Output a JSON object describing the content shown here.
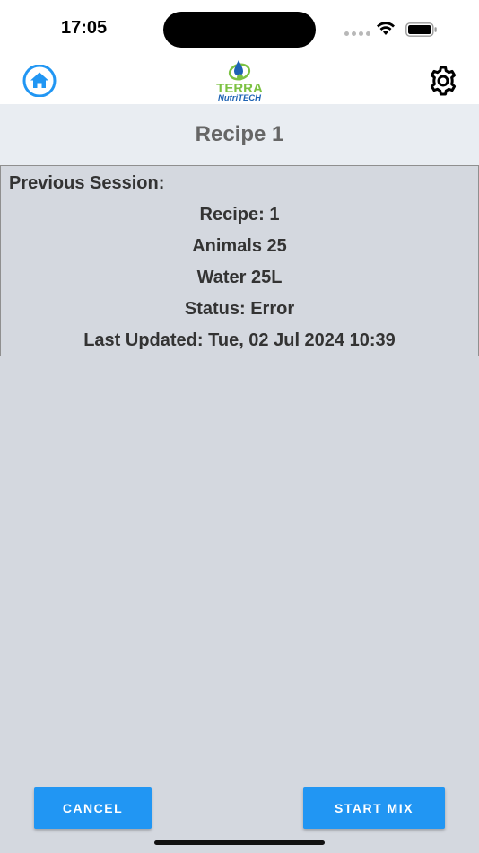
{
  "status_bar": {
    "time": "17:05"
  },
  "header": {
    "logo_line1": "TERRA",
    "logo_line2": "NutriTECH",
    "home_icon": "home-icon",
    "settings_icon": "gear-icon"
  },
  "title": "Recipe 1",
  "session": {
    "heading": "Previous Session:",
    "recipe": "Recipe: 1",
    "animals": "Animals 25",
    "water": "Water 25L",
    "status": "Status: Error",
    "last_updated": "Last Updated: Tue, 02 Jul 2024 10:39"
  },
  "buttons": {
    "cancel": "CANCEL",
    "start": "START MIX"
  },
  "colors": {
    "accent": "#2196f3",
    "background": "#d4d8df",
    "title_bar": "#e9edf2",
    "logo_green": "#7cc242",
    "logo_blue": "#1e63b4"
  }
}
